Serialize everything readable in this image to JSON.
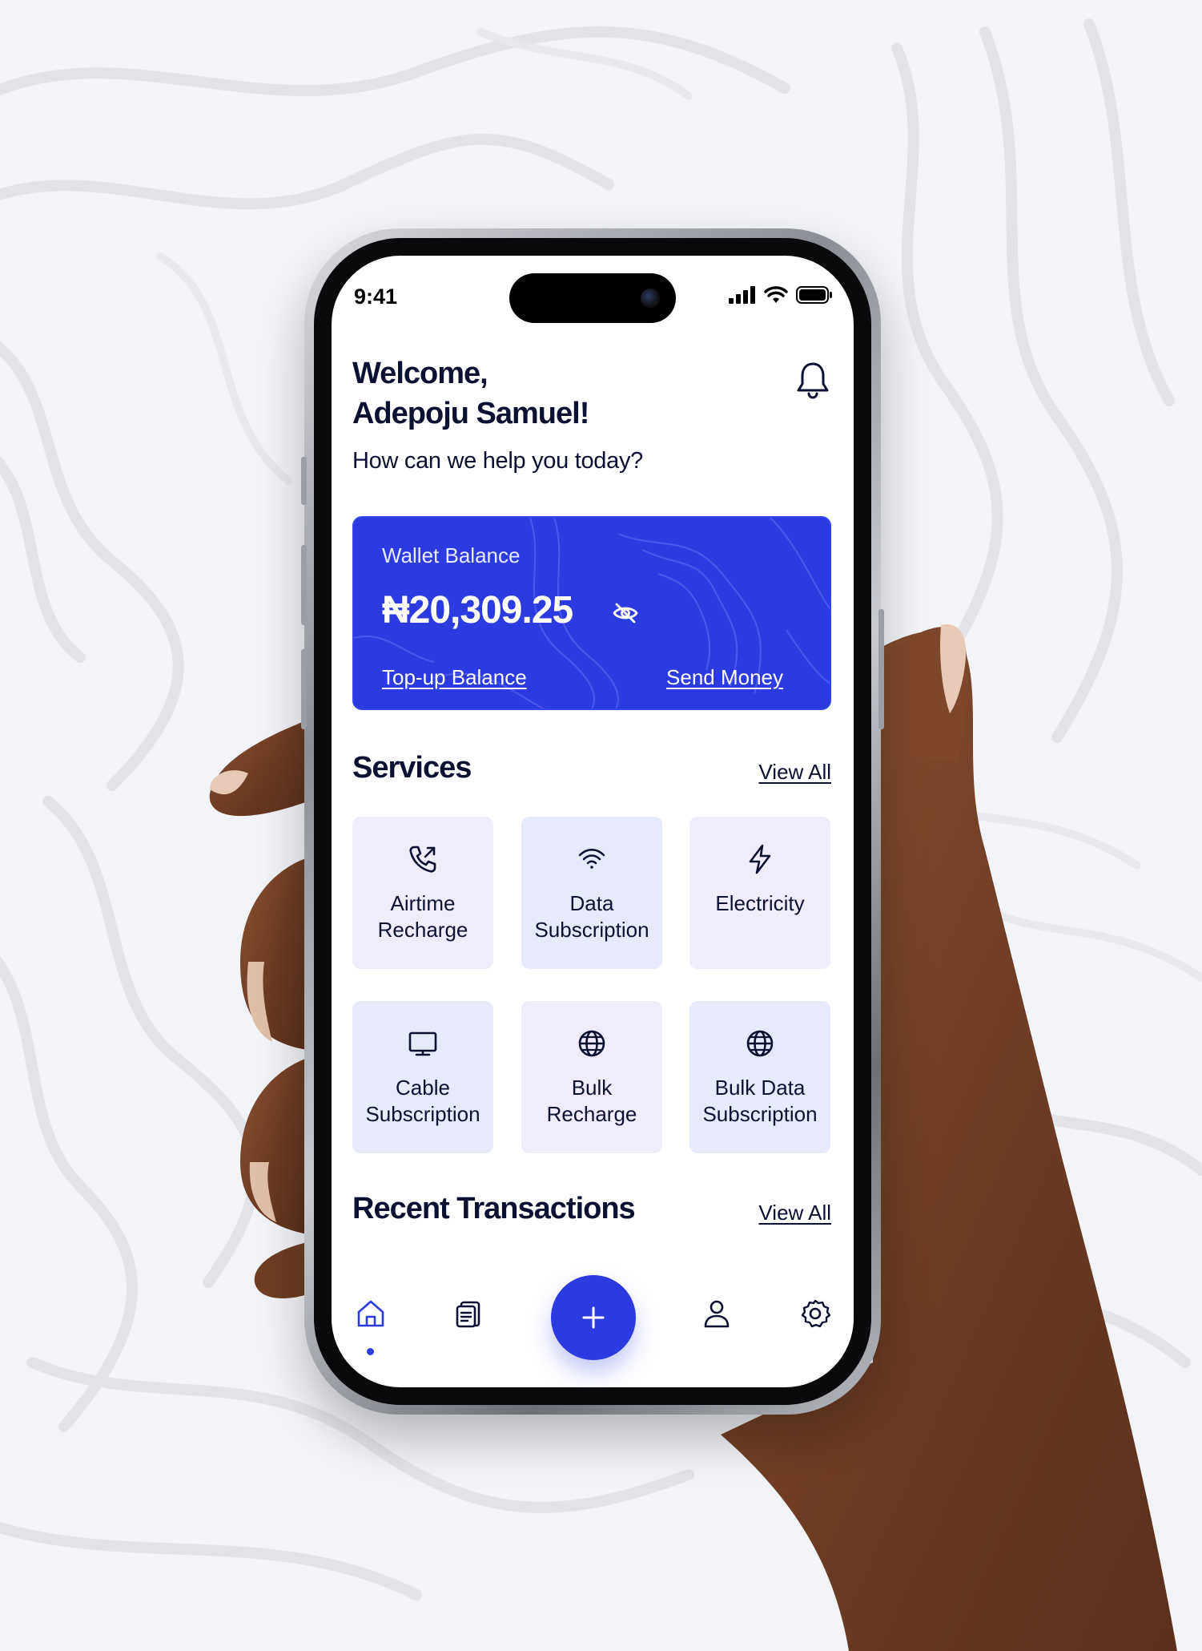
{
  "status_bar": {
    "time": "9:41"
  },
  "header": {
    "welcome_line1": "Welcome,",
    "welcome_line2": "Adepoju Samuel!",
    "subtitle": "How can we help you today?",
    "notification_icon": "bell-icon"
  },
  "wallet": {
    "label": "Wallet Balance",
    "amount": "₦20,309.25",
    "hide_icon": "eye-off-icon",
    "topup_label": "Top-up Balance",
    "send_label": "Send Money",
    "color": "#2b3be0"
  },
  "services": {
    "title": "Services",
    "view_all": "View All",
    "items": [
      {
        "label_line1": "Airtime",
        "label_line2": "Recharge",
        "icon": "phone-outgoing-icon"
      },
      {
        "label_line1": "Data",
        "label_line2": "Subscription",
        "icon": "wifi-icon"
      },
      {
        "label_line1": "Electricity",
        "label_line2": "",
        "icon": "lightning-icon"
      },
      {
        "label_line1": "Cable",
        "label_line2": "Subscription",
        "icon": "monitor-icon"
      },
      {
        "label_line1": "Bulk",
        "label_line2": "Recharge",
        "icon": "globe-icon"
      },
      {
        "label_line1": "Bulk Data",
        "label_line2": "Subscription",
        "icon": "globe-icon"
      }
    ]
  },
  "transactions": {
    "title": "Recent Transactions",
    "view_all": "View All"
  },
  "bottom_nav": {
    "items": [
      "home-icon",
      "clipboard-icon",
      "plus-icon",
      "user-icon",
      "settings-icon"
    ],
    "active": "home-icon"
  },
  "colors": {
    "accent": "#2b3be0",
    "text_dark": "#0c1033",
    "tile_purple": "#f0ecfb",
    "tile_blue": "#e6eafb",
    "background": "#f3f4f8"
  }
}
